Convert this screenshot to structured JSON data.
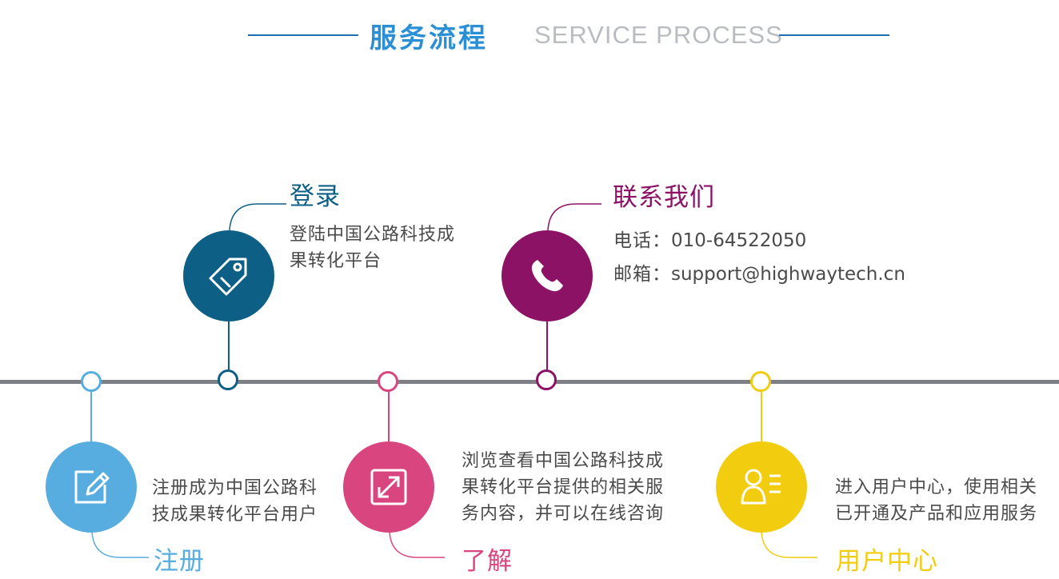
{
  "header": {
    "title_cn": "服务流程",
    "title_en": "SERVICE PROCESS"
  },
  "colors": {
    "header_line": "#1f6fae",
    "timeline": "#7f8085",
    "register": "#57ade0",
    "login": "#0e5f86",
    "learn": "#d9467f",
    "contact": "#8c1266",
    "user_center": "#f2cc0e"
  },
  "steps": {
    "register": {
      "title": "注册",
      "desc_line1": "注册成为中国公路科",
      "desc_line2": "技成果转化平台用户",
      "icon": "edit-icon"
    },
    "login": {
      "title": "登录",
      "desc_line1": "登陆中国公路科技成",
      "desc_line2": "果转化平台",
      "icon": "tag-icon"
    },
    "learn": {
      "title": "了解",
      "desc_line1": "浏览查看中国公路科技成",
      "desc_line2": "果转化平台提供的相关服",
      "desc_line3": "务内容，并可以在线咨询",
      "icon": "expand-icon"
    },
    "contact": {
      "title": "联系我们",
      "phone_label": "电话：",
      "phone": "010-64522050",
      "email_label": "邮箱：",
      "email": "support@highwaytech.cn",
      "icon": "phone-icon"
    },
    "user_center": {
      "title": "用户中心",
      "desc_line1": "进入用户中心，使用相关",
      "desc_line2": "已开通及产品和应用服务",
      "icon": "user-list-icon"
    }
  }
}
